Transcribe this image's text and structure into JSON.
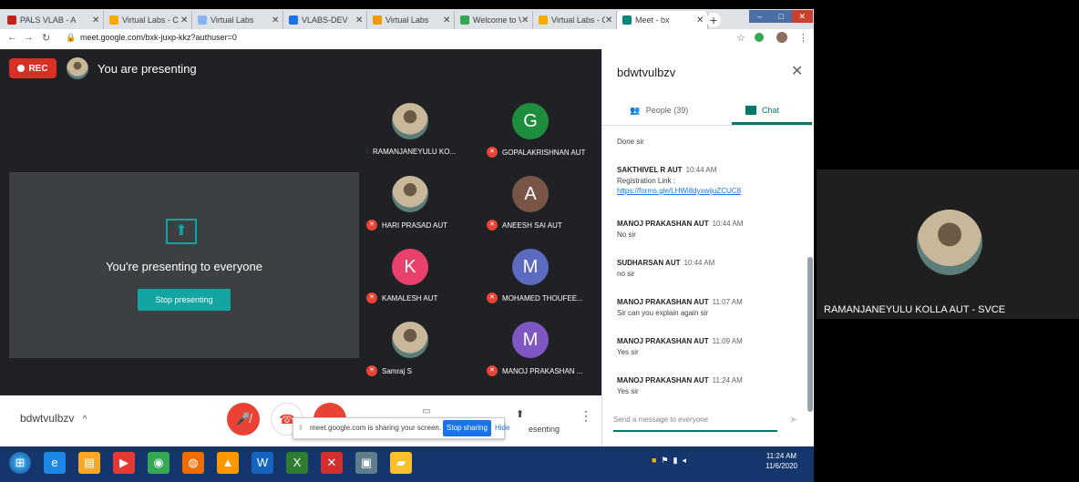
{
  "browser": {
    "tabs": [
      {
        "label": "PALS VLAB - A",
        "fav_color": "#c5221f",
        "active": false
      },
      {
        "label": "Virtual Labs - C",
        "fav_color": "#f9ab00",
        "active": false
      },
      {
        "label": "Virtual Labs",
        "fav_color": "#8ab4f8",
        "active": false
      },
      {
        "label": "VLABS-DEV",
        "fav_color": "#1a73e8",
        "active": false
      },
      {
        "label": "Virtual Labs",
        "fav_color": "#f29900",
        "active": false
      },
      {
        "label": "Welcome to V",
        "fav_color": "#34a853",
        "active": false
      },
      {
        "label": "Virtual Labs - C",
        "fav_color": "#f9ab00",
        "active": false
      },
      {
        "label": "Meet - bx",
        "fav_color": "#00897b",
        "active": true
      }
    ],
    "url": "meet.google.com/bxk-juxp-kkz?authuser=0",
    "new_tab": "+",
    "win_min": "–",
    "win_max": "□",
    "win_close": "✕"
  },
  "stage": {
    "rec_label": "REC",
    "presenting_top": "You are presenting",
    "present_message": "You're presenting to everyone",
    "stop_presenting": "Stop presenting",
    "present_icon": "⬆"
  },
  "participants": [
    {
      "name": "RAMANJANEYULU KO...",
      "initial": "",
      "color": "",
      "photo": true,
      "speaking": true
    },
    {
      "name": "GOPALAKRISHNAN AUT",
      "initial": "G",
      "color": "#1e8e3e",
      "photo": false,
      "speaking": false
    },
    {
      "name": "HARI PRASAD AUT",
      "initial": "",
      "color": "",
      "photo": true,
      "speaking": false
    },
    {
      "name": "ANEESH SAI AUT",
      "initial": "A",
      "color": "#795548",
      "photo": false,
      "speaking": false
    },
    {
      "name": "KAMALESH AUT",
      "initial": "K",
      "color": "#e8416b",
      "photo": false,
      "speaking": false
    },
    {
      "name": "MOHAMED THOUFEE...",
      "initial": "M",
      "color": "#5c6bc0",
      "photo": false,
      "speaking": false
    },
    {
      "name": "Samraj S",
      "initial": "",
      "color": "",
      "photo": true,
      "speaking": false
    },
    {
      "name": "MANOJ PRAKASHAN ...",
      "initial": "M",
      "color": "#7e57c2",
      "photo": false,
      "speaking": false
    }
  ],
  "bottombar": {
    "meeting_code": "bdwtvulbzv",
    "share_message": "meet.google.com is sharing your screen.",
    "stop_sharing": "Stop sharing",
    "hide": "Hide",
    "presenting_label": "esenting",
    "more": "⋮"
  },
  "panel": {
    "title": "bdwtvulbzv",
    "close": "✕",
    "people_tab": "People (39)",
    "chat_tab": "Chat",
    "messages": [
      {
        "sender": "",
        "time": "",
        "text": "Done sir",
        "link": ""
      },
      {
        "sender": "SAKTHIVEL R AUT",
        "time": "10:44 AM",
        "text": "Registration Link :",
        "link": "https://forms.gle/LHWi8dyxwijuZCUC8"
      },
      {
        "sender": "MANOJ PRAKASHAN AUT",
        "time": "10:44 AM",
        "text": "No sir",
        "link": ""
      },
      {
        "sender": "SUDHARSAN AUT",
        "time": "10:44 AM",
        "text": "no sir",
        "link": ""
      },
      {
        "sender": "MANOJ PRAKASHAN AUT",
        "time": "11:07 AM",
        "text": "Sir can you explain again sir",
        "link": ""
      },
      {
        "sender": "MANOJ PRAKASHAN AUT",
        "time": "11:09 AM",
        "text": "Yes sir",
        "link": ""
      },
      {
        "sender": "MANOJ PRAKASHAN AUT",
        "time": "11:24 AM",
        "text": "Yes sir",
        "link": ""
      }
    ],
    "input_placeholder": "Send a message to everyone"
  },
  "selfview": {
    "name": "RAMANJANEYULU KOLLA AUT - SVCE"
  },
  "taskbar": {
    "apps": [
      "start-orb",
      "internet-explorer",
      "file-explorer",
      "media-player",
      "chrome",
      "firefox",
      "vlc",
      "word",
      "excel",
      "x-app",
      "desktop-app",
      "folder"
    ],
    "time": "11:24 AM",
    "date": "11/6/2020"
  }
}
